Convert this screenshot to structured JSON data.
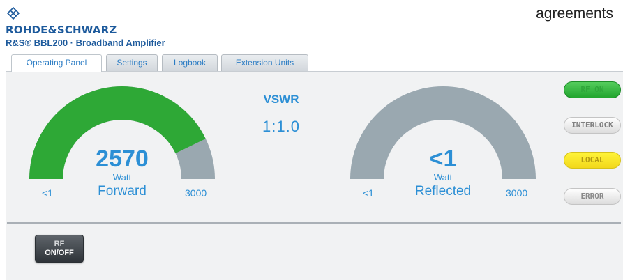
{
  "corner_text": "agreements",
  "brand": {
    "name": "ROHDE&SCHWARZ",
    "product": "R&S® BBL200 · Broadband Amplifier"
  },
  "tabs": [
    {
      "label": "Operating Panel",
      "active": true
    },
    {
      "label": "Settings",
      "active": false
    },
    {
      "label": "Logbook",
      "active": false
    },
    {
      "label": "Extension Units",
      "active": false
    }
  ],
  "forward": {
    "value": "2570",
    "unit": "Watt",
    "label": "Forward",
    "min_label": "<1",
    "max_label": "3000",
    "fill_fraction": 0.8567,
    "fill_color": "#2ea836",
    "track_color": "#9aa8b0"
  },
  "vswr": {
    "title": "VSWR",
    "value": "1:1.0"
  },
  "reflected": {
    "value": "<1",
    "unit": "Watt",
    "label": "Reflected",
    "min_label": "<1",
    "max_label": "3000",
    "fill_fraction": 0,
    "fill_color": "#2ea836",
    "track_color": "#9aa8b0"
  },
  "status": {
    "rf_on": "RF ON",
    "interlock": "INTERLOCK",
    "local": "LOCAL",
    "error": "ERROR"
  },
  "rf_button": {
    "line1": "RF",
    "line2": "ON/OFF"
  },
  "colors": {
    "accent_text": "#2c8fd5",
    "brand_blue": "#1d5a9c"
  }
}
